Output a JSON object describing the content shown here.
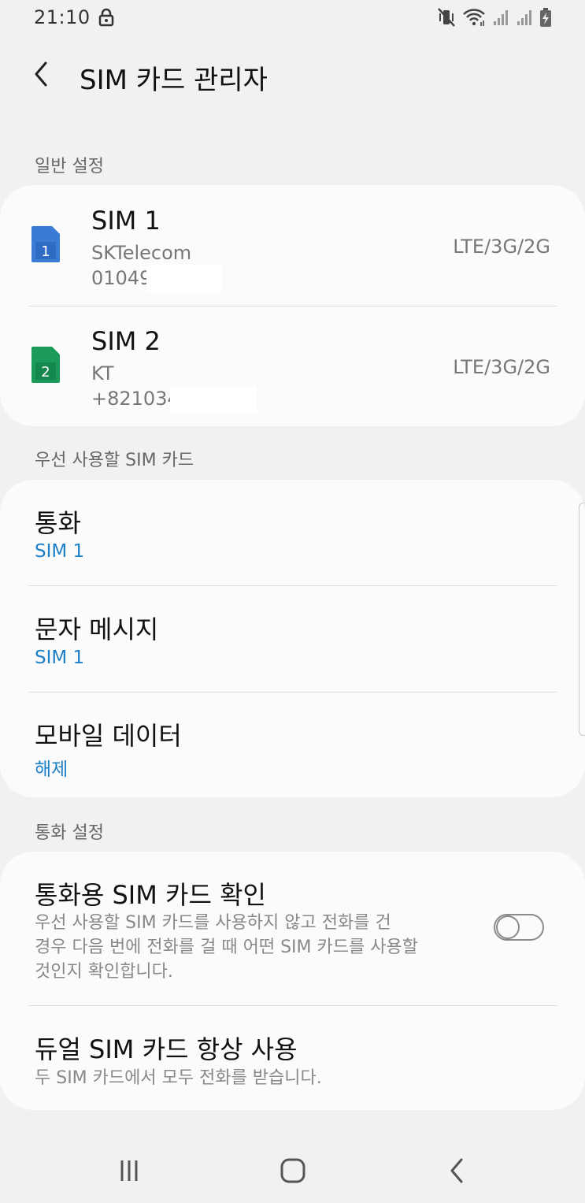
{
  "status_bar": {
    "time": "21:10",
    "icons": [
      "lock-icon",
      "mute-vibrate-icon",
      "wifi-icon",
      "signal-sim1-icon",
      "signal-sim2-icon",
      "battery-charging-icon"
    ]
  },
  "app_bar": {
    "title": "SIM 카드 관리자"
  },
  "general": {
    "label": "일반 설정",
    "sims": [
      {
        "name": "SIM 1",
        "carrier": "SKTelecom",
        "number": "01049",
        "network": "LTE/3G/2G",
        "icon_number": "1",
        "color": "#3a7bd5"
      },
      {
        "name": "SIM 2",
        "carrier": "KT",
        "number": "+821034",
        "network": "LTE/3G/2G",
        "icon_number": "2",
        "color": "#1a9b5a"
      }
    ]
  },
  "preferred": {
    "label": "우선 사용할 SIM 카드",
    "items": [
      {
        "title": "통화",
        "value": "SIM 1"
      },
      {
        "title": "문자 메시지",
        "value": "SIM 1"
      },
      {
        "title": "모바일 데이터",
        "value": "해제"
      }
    ]
  },
  "call_settings": {
    "label": "통화 설정",
    "confirm_sim": {
      "title": "통화용 SIM 카드 확인",
      "desc_line1": "우선 사용할 SIM 카드를 사용하지 않고 전화를 건",
      "desc_line2": "경우 다음 번에 전화를 걸 때 어떤 SIM 카드를 사용할",
      "desc_line3": "것인지 확인합니다.",
      "enabled": false
    },
    "dual_sim": {
      "title": "듀얼 SIM 카드 항상 사용",
      "desc": "두 SIM 카드에서 모두 전화를 받습니다."
    }
  },
  "colors": {
    "background": "#f1f1f1",
    "card": "#fbfbfb",
    "accent_value": "#1d7fc6"
  },
  "nav_bar": {
    "icons": [
      "recents-icon",
      "home-icon",
      "back-icon"
    ]
  }
}
